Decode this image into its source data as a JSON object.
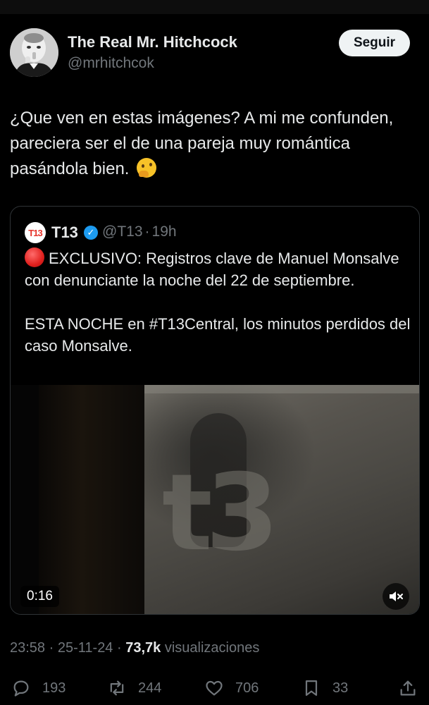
{
  "author": {
    "name": "The Real Mr. Hitchcock",
    "handle": "@mrhitchcok",
    "follow_label": "Seguir"
  },
  "tweet": {
    "text": "¿Que ven en estas imágenes? A mi me confunden, pareciera ser el de una pareja muy romántica pasándola bien."
  },
  "quote": {
    "logo": "T13",
    "name": "T13",
    "handle": "@T13",
    "separator": "·",
    "time": "19h",
    "text_main": "EXCLUSIVO: Registros clave de Manuel Monsalve con denunciante la noche del 22 de septiembre.",
    "text_second": " ESTA NOCHE en #T13Central, los minutos perdidos del caso Monsalve.",
    "video": {
      "watermark": "t3",
      "duration": "0:16",
      "mute_icon": "speaker-muted-icon"
    }
  },
  "meta": {
    "time": "23:58",
    "separator": "·",
    "date": "25-11-24",
    "views_count": "73,7k",
    "views_label": "visualizaciones"
  },
  "actions": {
    "replies": "193",
    "reposts": "244",
    "likes": "706",
    "bookmarks": "33"
  },
  "colors": {
    "background": "#000000",
    "text": "#e7e9ea",
    "muted": "#71767b",
    "verified": "#1d9bf0",
    "follow_bg": "#eff3f4"
  }
}
